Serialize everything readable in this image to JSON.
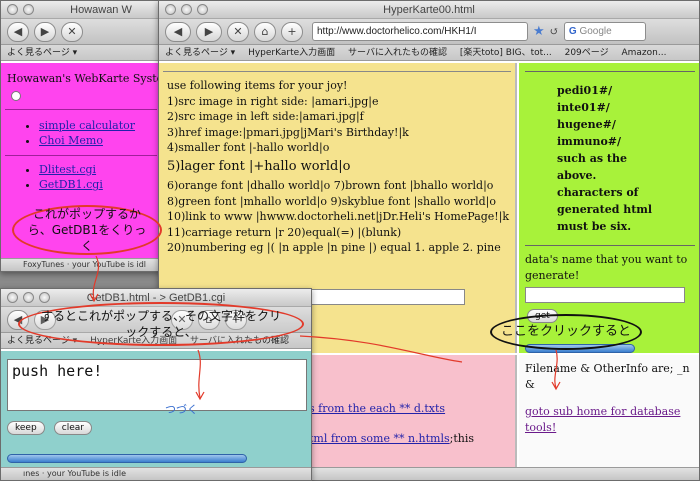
{
  "win_left": {
    "title": "Howawan W",
    "heading": "Howawan's WebKarte System",
    "links": [
      "simple calculator",
      "Choi Memo",
      "Dlitest.cgi",
      "GetDB1.cgi"
    ],
    "status": "FoxyTunes · your YouTube is idl"
  },
  "win_main": {
    "title": "HyperKarte00.html",
    "url": "http://www.doctorhelico.com/HKH1/I",
    "search_placeholder": "Google",
    "bookmarks": [
      "よく見るページ ▾",
      "HyperKarte入力画面",
      "サーバに入れたもの確認",
      "[楽天toto] BIG、tot...",
      "209ページ",
      "Amazon..."
    ],
    "center_lines": [
      "use following items for your joy!",
      "1)src image in right side: |amari.jpg|e",
      "2)src image in left side:|amari.jpg|f",
      "3)href image:|pmari.jpg|jMari's Birthday!|k",
      "4)smaller font |-hallo world|o",
      "5)lager font |+hallo world|o",
      "6)orange font |dhallo world|o 7)brown font |bhallo world|o",
      "8)green font |mhallo world|o 9)skyblue font |shallo world|o",
      "10)link to www |hwww.doctorheli.net|jDr.Heli's HomePage!|k",
      "11)carriage return |r 20)equal(=) |(blunk)",
      "20)numbering eg |( |n apple |n pine |) equal 1. apple 2. pine"
    ],
    "right_lines": [
      "pedi01#/",
      "inte01#/",
      "hugene#/",
      "immuno#/",
      "such as the",
      "above.",
      "characters of",
      "generated html",
      "must be six."
    ],
    "right_prompt": "data's name that you want to generate!",
    "get_label": "get",
    "bottom_right_text": "Filename & OtherInfo are; _n &",
    "bottom_right_link": "goto sub home for database tools!",
    "bottom_mid_link1": "s from the each ** d.txts",
    "bottom_mid_link2": "tml from some ** n.htmls",
    "bottom_mid_tail": ";this",
    "status": "ınes · your YouTube is idle"
  },
  "win_popup": {
    "title": "GetDB1.html - > GetDB1.cgi",
    "bookmarks": [
      "よく見るページ ▾",
      "HyperKarte入力画面",
      "サーバに入れたもの確認"
    ],
    "textarea_value": "push here!",
    "keep_label": "keep",
    "clear_label": "clear",
    "status": "ınes · your YouTube is idle"
  },
  "annotations": {
    "callout1": "これがポップするから、GetDB1をくりっく",
    "callout2": "するとこれがポップする、その文字枠をクリックすると、",
    "callout3": "ここをクリックすると",
    "tsuzuku": "つづく"
  },
  "colors": {
    "magenta": "#ff44ee",
    "khaki": "#f5e38e",
    "lime": "#a8f23a",
    "pink": "#f8c0cc",
    "teal": "#8fd0cc",
    "callout_red": "#e23a2a"
  }
}
